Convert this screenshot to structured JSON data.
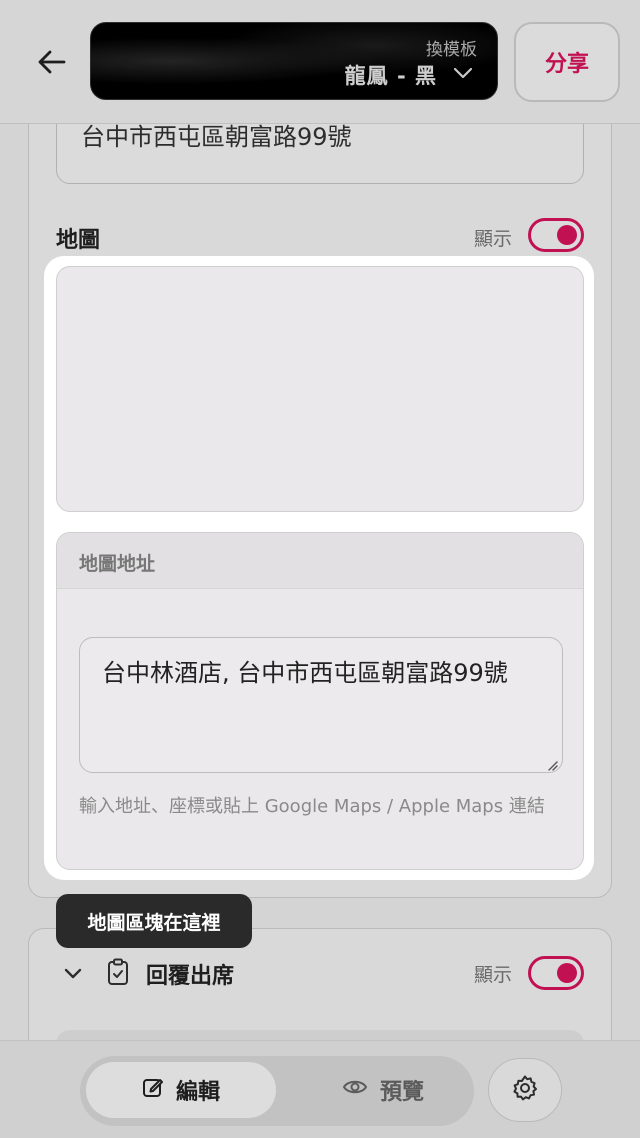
{
  "header": {
    "template_small_label": "換模板",
    "template_name": "龍鳳 - 黑",
    "share_label": "分享"
  },
  "previous_field": {
    "value": "台中市西屯區朝富路99號"
  },
  "map_section": {
    "title": "地圖",
    "show_label": "顯示",
    "address_card_title": "地圖地址",
    "address_value": "台中林酒店, 台中市西屯區朝富路99號",
    "hint": "輸入地址、座標或貼上 Google Maps / Apple Maps 連結"
  },
  "tooltip": {
    "text": "地圖區塊在這裡"
  },
  "rsvp_section": {
    "title": "回覆出席",
    "show_label": "顯示"
  },
  "bottom_bar": {
    "edit_label": "編輯",
    "preview_label": "預覽"
  },
  "colors": {
    "accent": "#d9135c",
    "tooltip_bg": "#2a2a2a"
  },
  "icons": [
    "back-arrow-icon",
    "chevron-down-icon",
    "clipboard-check-icon",
    "pencil-edit-icon",
    "eye-icon",
    "gear-icon"
  ]
}
